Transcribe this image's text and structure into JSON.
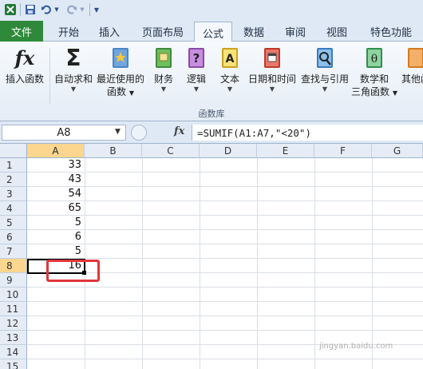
{
  "quick_access": {
    "icons": [
      "excel-logo-icon",
      "save-icon",
      "undo-icon",
      "redo-icon",
      "customize-icon"
    ]
  },
  "tabs": [
    {
      "label": "文件"
    },
    {
      "label": "开始"
    },
    {
      "label": "插入"
    },
    {
      "label": "页面布局"
    },
    {
      "label": "公式",
      "active": true
    },
    {
      "label": "数据"
    },
    {
      "label": "审阅"
    },
    {
      "label": "视图"
    },
    {
      "label": "特色功能"
    }
  ],
  "ribbon": {
    "buttons": [
      {
        "label": "插入函数",
        "label2": "",
        "icon": "fx-icon",
        "dropdown": false
      },
      {
        "label": "自动求和",
        "label2": "",
        "icon": "sigma-icon",
        "dropdown": true
      },
      {
        "label": "最近使用的",
        "label2": "函数",
        "icon": "recent-book-icon",
        "dropdown": true
      },
      {
        "label": "财务",
        "label2": "",
        "icon": "finance-book-icon",
        "dropdown": true
      },
      {
        "label": "逻辑",
        "label2": "",
        "icon": "logic-book-icon",
        "dropdown": true
      },
      {
        "label": "文本",
        "label2": "",
        "icon": "text-book-icon",
        "dropdown": true
      },
      {
        "label": "日期和时间",
        "label2": "",
        "icon": "date-book-icon",
        "dropdown": true
      },
      {
        "label": "查找与引用",
        "label2": "",
        "icon": "lookup-book-icon",
        "dropdown": true
      },
      {
        "label": "数学和",
        "label2": "三角函数",
        "icon": "math-book-icon",
        "dropdown": true
      },
      {
        "label": "其他函",
        "label2": "",
        "icon": "other-book-icon",
        "dropdown": false
      }
    ],
    "group_label": "函数库"
  },
  "formula_bar": {
    "name_box": "A8",
    "fx_label": "fx",
    "formula": "=SUMIF(A1:A7,\"<20\")"
  },
  "sheet": {
    "columns": [
      "A",
      "B",
      "C",
      "D",
      "E",
      "F",
      "G"
    ],
    "rows": [
      "1",
      "2",
      "3",
      "4",
      "5",
      "6",
      "7",
      "8",
      "9",
      "10",
      "11",
      "12",
      "13",
      "14",
      "15"
    ],
    "column_a_values": [
      "33",
      "43",
      "54",
      "65",
      "5",
      "6",
      "5",
      "16"
    ],
    "selected_row": "8",
    "selected_column": "A"
  },
  "watermark": "jingyan.baidu.com"
}
